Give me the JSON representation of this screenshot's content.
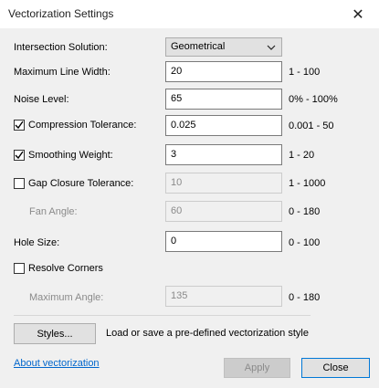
{
  "window": {
    "title": "Vectorization Settings",
    "close_glyph": "✕"
  },
  "fields": {
    "intersection": {
      "label": "Intersection Solution:",
      "value": "Geometrical"
    },
    "max_line_width": {
      "label": "Maximum Line Width:",
      "value": "20",
      "range": "1 - 100"
    },
    "noise_level": {
      "label": "Noise Level:",
      "value": "65",
      "range": "0% - 100%"
    },
    "compression": {
      "label": "Compression Tolerance:",
      "value": "0.025",
      "range": "0.001 - 50",
      "checked": true
    },
    "smoothing": {
      "label": "Smoothing Weight:",
      "value": "3",
      "range": "1 - 20",
      "checked": true
    },
    "gap_closure": {
      "label": "Gap Closure Tolerance:",
      "value": "10",
      "range": "1 - 1000",
      "checked": false
    },
    "fan_angle": {
      "label": "Fan Angle:",
      "value": "60",
      "range": "0 - 180"
    },
    "hole_size": {
      "label": "Hole Size:",
      "value": "0",
      "range": "0 - 100"
    },
    "resolve_corners": {
      "label": "Resolve Corners",
      "checked": false
    },
    "max_angle": {
      "label": "Maximum Angle:",
      "value": "135",
      "range": "0 - 180"
    }
  },
  "styles": {
    "button_label": "Styles...",
    "description": "Load or save a pre-defined vectorization style"
  },
  "footer": {
    "link_label": "About vectorization",
    "apply_label": "Apply",
    "close_label": "Close"
  },
  "icons": {
    "close": "close-icon",
    "check": "check-icon",
    "chevron": "chevron-down-icon"
  }
}
